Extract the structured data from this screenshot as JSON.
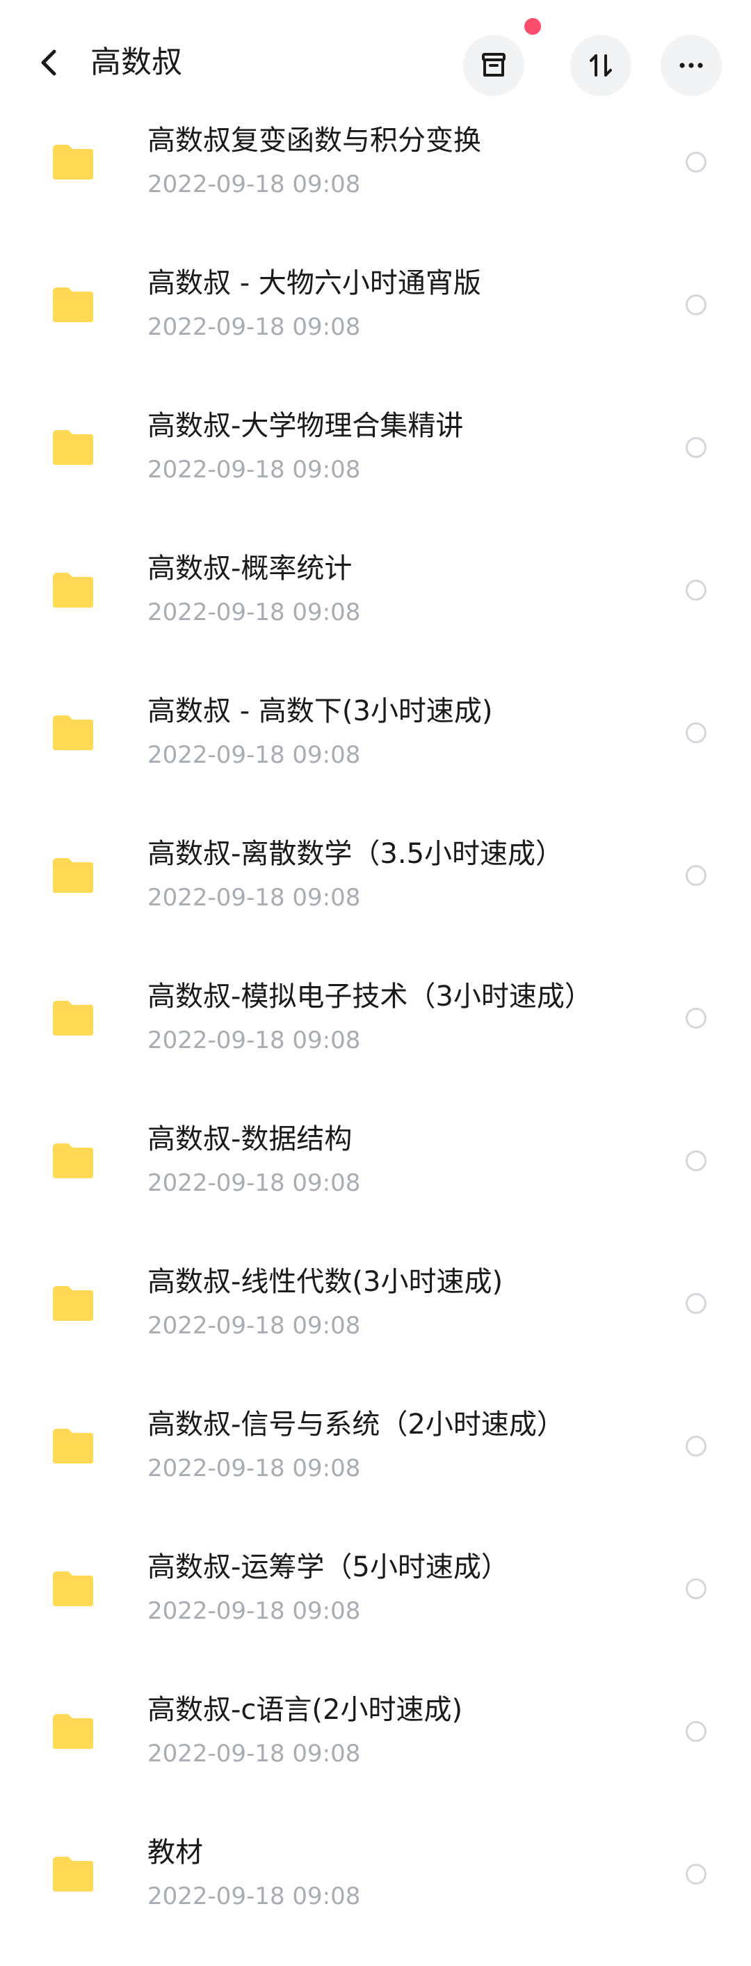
{
  "header": {
    "title": "高数叔",
    "icons": [
      "back-icon",
      "archive-icon",
      "sort-icon",
      "more-icon"
    ]
  },
  "colors": {
    "folder": "#ffd955",
    "notification_dot": "#ff4d6d",
    "date_text": "#a8acb3"
  },
  "items": [
    {
      "name": "高数叔复变函数与积分变换",
      "date": "2022-09-18  09:08"
    },
    {
      "name": "高数叔 - 大物六小时通宵版",
      "date": "2022-09-18  09:08"
    },
    {
      "name": "高数叔-大学物理合集精讲",
      "date": "2022-09-18  09:08"
    },
    {
      "name": "高数叔-概率统计",
      "date": "2022-09-18  09:08"
    },
    {
      "name": "高数叔 - 高数下(3小时速成)",
      "date": "2022-09-18  09:08"
    },
    {
      "name": "高数叔-离散数学（3.5小时速成）",
      "date": "2022-09-18  09:08"
    },
    {
      "name": "高数叔-模拟电子技术（3小时速成）",
      "date": "2022-09-18  09:08"
    },
    {
      "name": "高数叔-数据结构",
      "date": "2022-09-18  09:08"
    },
    {
      "name": "高数叔-线性代数(3小时速成)",
      "date": "2022-09-18  09:08"
    },
    {
      "name": "高数叔-信号与系统（2小时速成）",
      "date": "2022-09-18  09:08"
    },
    {
      "name": "高数叔-运筹学（5小时速成）",
      "date": "2022-09-18  09:08"
    },
    {
      "name": "高数叔-c语言(2小时速成)",
      "date": "2022-09-18  09:08"
    },
    {
      "name": "教材",
      "date": "2022-09-18  09:08"
    }
  ]
}
